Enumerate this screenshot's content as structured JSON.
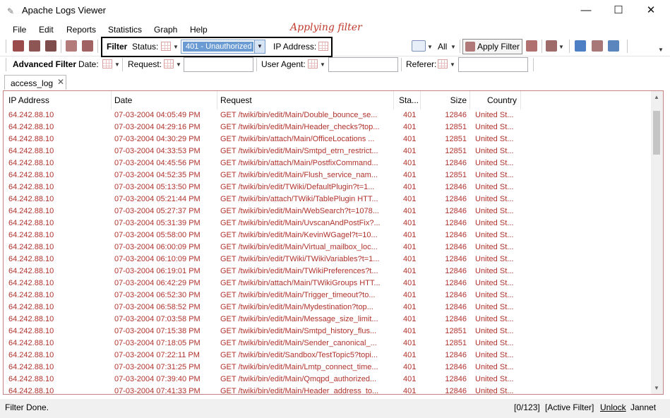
{
  "window": {
    "title": "Apache Logs Viewer"
  },
  "menu": [
    "File",
    "Edit",
    "Reports",
    "Statistics",
    "Graph",
    "Help"
  ],
  "annotation": "Applying filter",
  "filter": {
    "label": "Filter",
    "status_label": "Status:",
    "status_value": "401 - Unauthorized",
    "ip_label": "IP Address:",
    "all_label": "All",
    "apply_label": "Apply Filter"
  },
  "advanced": {
    "label": "Advanced Filter",
    "date_label": "Date:",
    "request_label": "Request:",
    "user_agent_label": "User Agent:",
    "referer_label": "Referer:"
  },
  "tabs": [
    {
      "label": "access_log"
    }
  ],
  "table": {
    "columns": [
      "IP Address",
      "Date",
      "Request",
      "Sta...",
      "Size",
      "Country"
    ],
    "rows": [
      [
        "64.242.88.10",
        "07-03-2004 04:05:49 PM",
        "GET /twiki/bin/edit/Main/Double_bounce_se...",
        "401",
        "12846",
        "United St..."
      ],
      [
        "64.242.88.10",
        "07-03-2004 04:29:16 PM",
        "GET /twiki/bin/edit/Main/Header_checks?top...",
        "401",
        "12851",
        "United St..."
      ],
      [
        "64.242.88.10",
        "07-03-2004 04:30:29 PM",
        "GET /twiki/bin/attach/Main/OfficeLocations ...",
        "401",
        "12851",
        "United St..."
      ],
      [
        "64.242.88.10",
        "07-03-2004 04:33:53 PM",
        "GET /twiki/bin/edit/Main/Smtpd_etrn_restrict...",
        "401",
        "12851",
        "United St..."
      ],
      [
        "64.242.88.10",
        "07-03-2004 04:45:56 PM",
        "GET /twiki/bin/attach/Main/PostfixCommand...",
        "401",
        "12846",
        "United St..."
      ],
      [
        "64.242.88.10",
        "07-03-2004 04:52:35 PM",
        "GET /twiki/bin/edit/Main/Flush_service_nam...",
        "401",
        "12851",
        "United St..."
      ],
      [
        "64.242.88.10",
        "07-03-2004 05:13:50 PM",
        "GET /twiki/bin/edit/TWiki/DefaultPlugin?t=1...",
        "401",
        "12846",
        "United St..."
      ],
      [
        "64.242.88.10",
        "07-03-2004 05:21:44 PM",
        "GET /twiki/bin/attach/TWiki/TablePlugin HTT...",
        "401",
        "12846",
        "United St..."
      ],
      [
        "64.242.88.10",
        "07-03-2004 05:27:37 PM",
        "GET /twiki/bin/edit/Main/WebSearch?t=1078...",
        "401",
        "12846",
        "United St..."
      ],
      [
        "64.242.88.10",
        "07-03-2004 05:31:39 PM",
        "GET /twiki/bin/edit/Main/UvscanAndPostFix?...",
        "401",
        "12846",
        "United St..."
      ],
      [
        "64.242.88.10",
        "07-03-2004 05:58:00 PM",
        "GET /twiki/bin/edit/Main/KevinWGagel?t=10...",
        "401",
        "12846",
        "United St..."
      ],
      [
        "64.242.88.10",
        "07-03-2004 06:00:09 PM",
        "GET /twiki/bin/edit/Main/Virtual_mailbox_loc...",
        "401",
        "12846",
        "United St..."
      ],
      [
        "64.242.88.10",
        "07-03-2004 06:10:09 PM",
        "GET /twiki/bin/edit/TWiki/TWikiVariables?t=1...",
        "401",
        "12846",
        "United St..."
      ],
      [
        "64.242.88.10",
        "07-03-2004 06:19:01 PM",
        "GET /twiki/bin/edit/Main/TWikiPreferences?t...",
        "401",
        "12846",
        "United St..."
      ],
      [
        "64.242.88.10",
        "07-03-2004 06:42:29 PM",
        "GET /twiki/bin/attach/Main/TWikiGroups HTT...",
        "401",
        "12846",
        "United St..."
      ],
      [
        "64.242.88.10",
        "07-03-2004 06:52:30 PM",
        "GET /twiki/bin/edit/Main/Trigger_timeout?to...",
        "401",
        "12846",
        "United St..."
      ],
      [
        "64.242.88.10",
        "07-03-2004 06:58:52 PM",
        "GET /twiki/bin/edit/Main/Mydestination?top...",
        "401",
        "12846",
        "United St..."
      ],
      [
        "64.242.88.10",
        "07-03-2004 07:03:58 PM",
        "GET /twiki/bin/edit/Main/Message_size_limit...",
        "401",
        "12846",
        "United St..."
      ],
      [
        "64.242.88.10",
        "07-03-2004 07:15:38 PM",
        "GET /twiki/bin/edit/Main/Smtpd_history_flus...",
        "401",
        "12851",
        "United St..."
      ],
      [
        "64.242.88.10",
        "07-03-2004 07:18:05 PM",
        "GET /twiki/bin/edit/Main/Sender_canonical_...",
        "401",
        "12851",
        "United St..."
      ],
      [
        "64.242.88.10",
        "07-03-2004 07:22:11 PM",
        "GET /twiki/bin/edit/Sandbox/TestTopic5?topi...",
        "401",
        "12846",
        "United St..."
      ],
      [
        "64.242.88.10",
        "07-03-2004 07:31:25 PM",
        "GET /twiki/bin/edit/Main/Lmtp_connect_time...",
        "401",
        "12846",
        "United St..."
      ],
      [
        "64.242.88.10",
        "07-03-2004 07:39:40 PM",
        "GET /twiki/bin/edit/Main/Qmqpd_authorized...",
        "401",
        "12846",
        "United St..."
      ],
      [
        "64.242.88.10",
        "07-03-2004 07:41:33 PM",
        "GET /twiki/bin/edit/Main/Header_address_to...",
        "401",
        "12846",
        "United St..."
      ]
    ]
  },
  "status": {
    "left": "Filter Done.",
    "count": "[0/123]",
    "active_filter": "[Active Filter]",
    "unlock": "Unlock",
    "user": "Jannet"
  },
  "colors": {
    "row_text": "#b0322c",
    "annotation": "#c0392b",
    "grid_border": "#c48282"
  },
  "icons": [
    "app-icon",
    "minimize-icon",
    "maximize-icon",
    "close-icon"
  ]
}
